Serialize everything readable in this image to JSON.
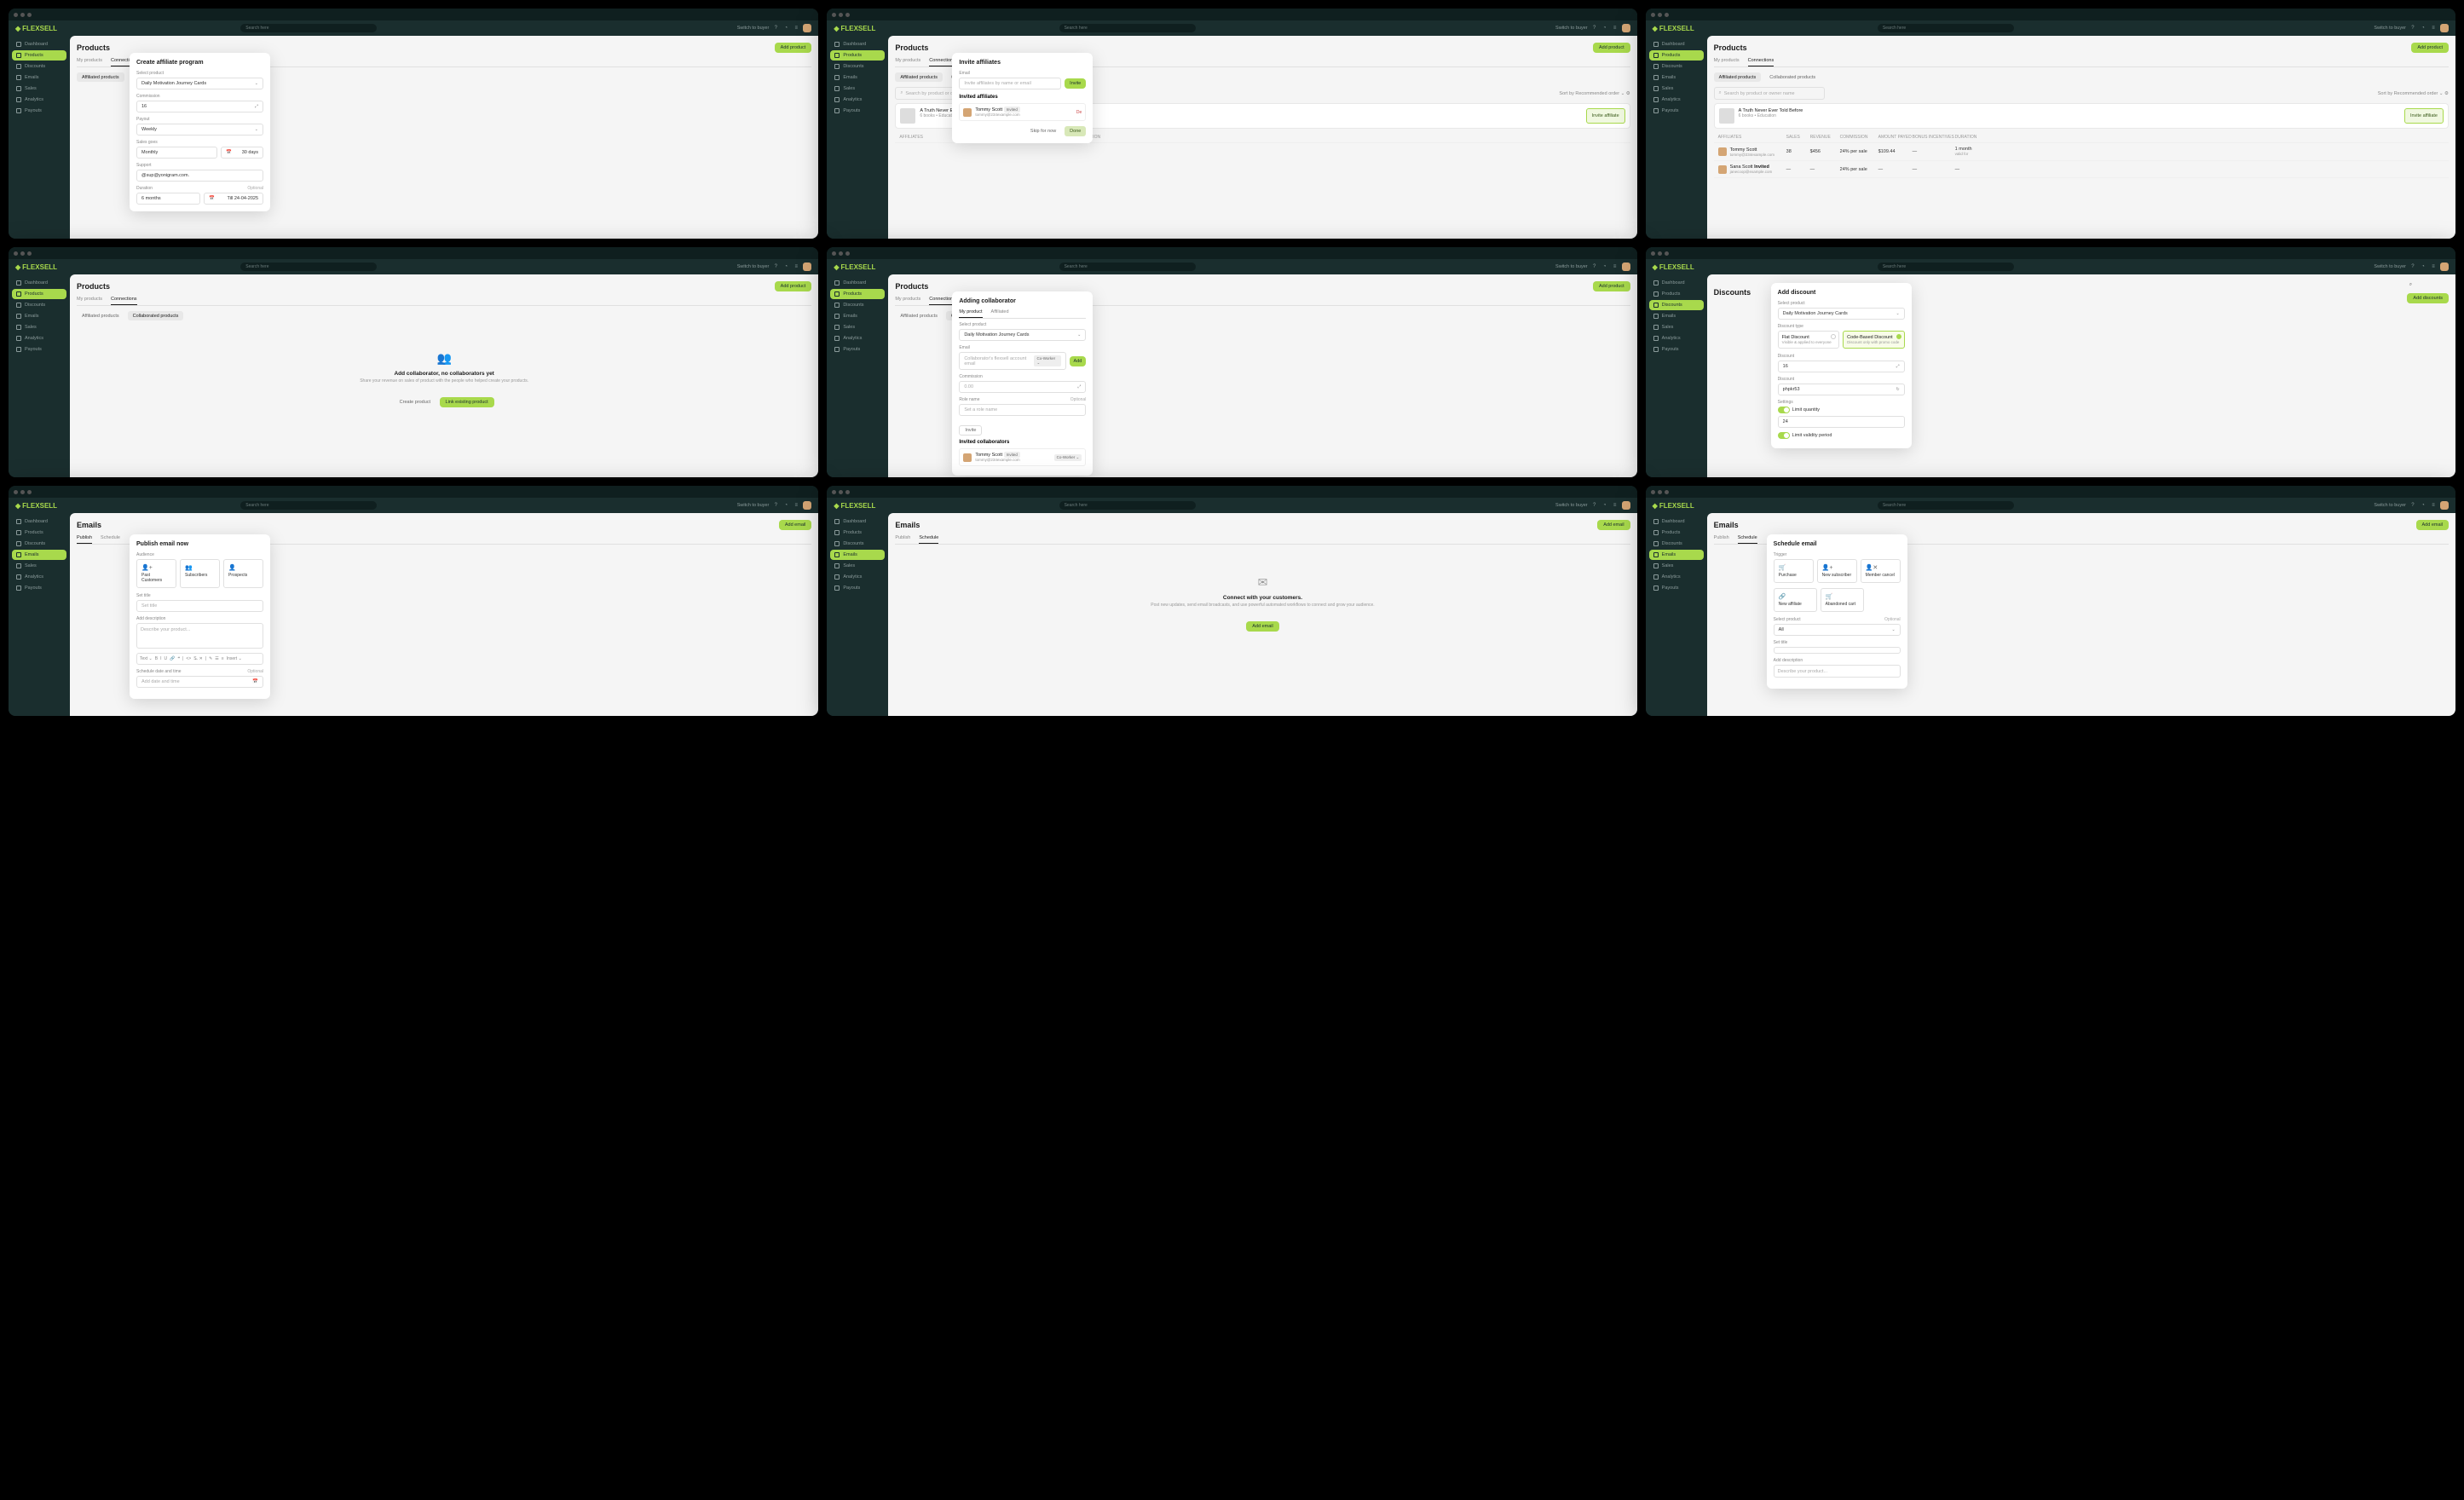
{
  "brand": "FLEXSELL",
  "search_ph": "Search here",
  "switch": "Switch to buyer",
  "nav": {
    "dashboard": "Dashboard",
    "products": "Products",
    "discounts": "Discounts",
    "emails": "Emails",
    "sales": "Sales",
    "analytics": "Analytics",
    "payouts": "Payouts"
  },
  "products": {
    "title": "Products",
    "add": "Add product",
    "tabs": {
      "my": "My products",
      "conn": "Connections",
      "affiliated": "Affiliated"
    },
    "subtabs": {
      "aff": "Affiliated products",
      "collab": "Collaborated products",
      "c1": "Colla",
      "c2": "Collat"
    }
  },
  "af_modal": {
    "title": "Create affiliate program",
    "select": "Select product",
    "product": "Daily Motivation Journey Cards",
    "commission": "Commission",
    "commission_val": "16",
    "payout": "Payout",
    "payout_val": "Weekly",
    "sales": "Sales goes",
    "sales_val": "Monthly",
    "days": "30 days",
    "support": "Support",
    "support_val": "@sup@yonigram.com.",
    "duration": "Duration",
    "duration_val": "6 months",
    "till": "Till 24-04-2025",
    "optional": "Optional"
  },
  "inv_modal": {
    "title": "Invite affiliates",
    "email": "Email",
    "email_ph": "Invite affiliates by name or email",
    "invite": "Invite",
    "invited": "Invited affiliates",
    "user": "Tommy Scott",
    "status": "Invited",
    "user_email": "tommy@234example.com",
    "skip": "Skip for now",
    "done": "Done",
    "del": "De"
  },
  "pview": {
    "search": "Search by product or owner name",
    "sort": "Sort by",
    "sort_val": "Recommended order",
    "prod1": "A Truth Never Ever Told",
    "prod2": "A Truth Never Ever Told Before",
    "meta": "6 books • Education",
    "invite": "Invite affiliate",
    "th": {
      "aff": "AFFILIATES",
      "sales": "SALES",
      "rev": "REVENUE",
      "comm": "COMMISSION",
      "paid": "AMOUNT PAYED",
      "bonus": "BONUS INCENTIVES",
      "dur": "DURATION"
    },
    "u1": {
      "name": "Tommy Scott",
      "email": "tommy@234example.com",
      "sales": "38",
      "rev": "$456",
      "comm": "24% per sale",
      "paid": "$109.44",
      "dur": "1 month",
      "dur2": "valid for"
    },
    "u2": {
      "name": "Sana Scott",
      "status": "Invited",
      "email": "janecoop@example.com",
      "comm": "24% per sale"
    }
  },
  "collab_empty": {
    "title": "Add collaborator, no collaborators yet",
    "desc": "Share your revenue on sales of product with the people who helped create your products.",
    "create": "Create product",
    "link": "Link existing product"
  },
  "collab_modal": {
    "title": "Adding collaborator",
    "tab1": "My product",
    "tab2": "Affiliated",
    "select": "Select product",
    "product": "Daily Motivation Journey Cards",
    "email": "Email",
    "email_ph": "Collaborator's flexsell account email",
    "coworker": "Co-Worker",
    "add": "Add",
    "commission": "Commission",
    "comm_ph": "0.00",
    "role": "Role name",
    "role_ph": "Set a role name",
    "optional": "Optional",
    "invite": "Invite",
    "invited": "Invited collaborators",
    "user": "Tommy Scott",
    "status": "Invited",
    "user_email": "tommy@234example.com"
  },
  "disc": {
    "title": "Discounts",
    "add": "Add discounts",
    "modal": {
      "title": "Add discount",
      "select": "Select product",
      "product": "Daily Motivation Journey Cards",
      "type": "Discount type",
      "flat": "Flat Discount",
      "flat_d": "Visible & applied to everyone",
      "code": "Code-Based Discount",
      "code_d": "Discount only with promo code",
      "discount": "Discount",
      "disc_val": "16",
      "code_val": "phpkr53",
      "settings": "Settings",
      "limit_q": "Limit quantity",
      "qty": "24",
      "limit_v": "Limit validity period"
    }
  },
  "emails": {
    "title": "Emails",
    "add": "Add email",
    "tabs": {
      "pub": "Publish",
      "sched": "Schedule"
    }
  },
  "pub_modal": {
    "title": "Publish email now",
    "audience": "Audience",
    "past": "Past Customers",
    "subs": "Subscribers",
    "pros": "Prospects",
    "set_title": "Set title",
    "title_ph": "Set title",
    "add_desc": "Add description",
    "desc_ph": "Describe your product...",
    "text": "Text",
    "insert": "Insert",
    "sched": "Schedule date and time",
    "sched_ph": "Add date and time",
    "optional": "Optional"
  },
  "connect": {
    "title": "Connect with your customers.",
    "desc": "Post new updates, send email broadcasts, and use powerful automated workflows to connect and grow your audience.",
    "add": "Add email"
  },
  "sched_modal": {
    "title": "Schedule email",
    "trigger": "Trigger",
    "purchase": "Purchase",
    "newsub": "New subscriber",
    "cancel": "Member cancel",
    "newaff": "New affiliate",
    "cart": "Abandoned cart",
    "select": "Select product",
    "all": "All",
    "optional": "Optional",
    "set_title": "Set title",
    "desc": "Add description",
    "desc_ph": "Describe your product..."
  }
}
